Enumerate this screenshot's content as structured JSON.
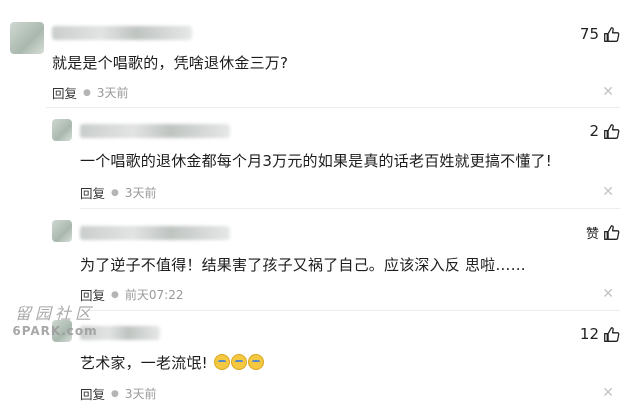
{
  "watermark": {
    "chars": "留园社区",
    "site": "6PARK.com"
  },
  "comments": [
    {
      "likes": "75",
      "text": "就是是个唱歌的，凭啥退休金三万?",
      "reply": "回复",
      "time": "3天前"
    },
    {
      "likes": "2",
      "text": "一个唱歌的退休金都每个月3万元的如果是真的话老百姓就更搞不懂了!",
      "reply": "回复",
      "time": "3天前"
    },
    {
      "likes": "赞",
      "text": "为了逆子不值得！结果害了孩子又祸了自己。应该深入反 思啦……",
      "reply": "回复",
      "time": "前天07:22"
    },
    {
      "likes": "12",
      "text": "艺术家，一老流氓!",
      "reply": "回复",
      "time": "3天前"
    }
  ]
}
